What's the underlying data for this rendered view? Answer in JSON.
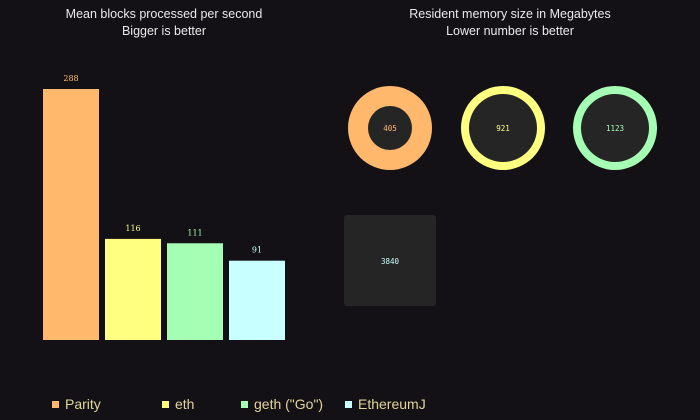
{
  "left_title": {
    "line1": "Mean blocks processed per second",
    "line2": "Bigger is better"
  },
  "right_title": {
    "line1": "Resident memory size in Megabytes",
    "line2": "Lower number is better"
  },
  "colors": {
    "Parity": "#ffb86c",
    "eth": "#ffff80",
    "geth": "#a4ffb4",
    "EthereumJ": "#c8ffff",
    "background": "#131115",
    "panel": "#252525"
  },
  "legend": [
    {
      "label": "Parity",
      "color": "#ffb86c"
    },
    {
      "label": "eth",
      "color": "#ffff80"
    },
    {
      "label": "geth (\"Go\")",
      "color": "#a4ffb4"
    },
    {
      "label": "EthereumJ",
      "color": "#c8ffff"
    }
  ],
  "chart_data": [
    {
      "type": "bar",
      "title": "Mean blocks processed per second",
      "subtitle": "Bigger is better",
      "categories": [
        "Parity",
        "eth",
        "geth (\"Go\")",
        "EthereumJ"
      ],
      "values": [
        288,
        116,
        111,
        91
      ],
      "ylim": [
        0,
        288
      ],
      "grid": false
    },
    {
      "type": "bubble",
      "title": "Resident memory size in Megabytes",
      "subtitle": "Lower number is better",
      "categories": [
        "Parity",
        "eth",
        "geth (\"Go\")",
        "EthereumJ"
      ],
      "values": [
        405,
        921,
        1123,
        3840
      ]
    }
  ]
}
